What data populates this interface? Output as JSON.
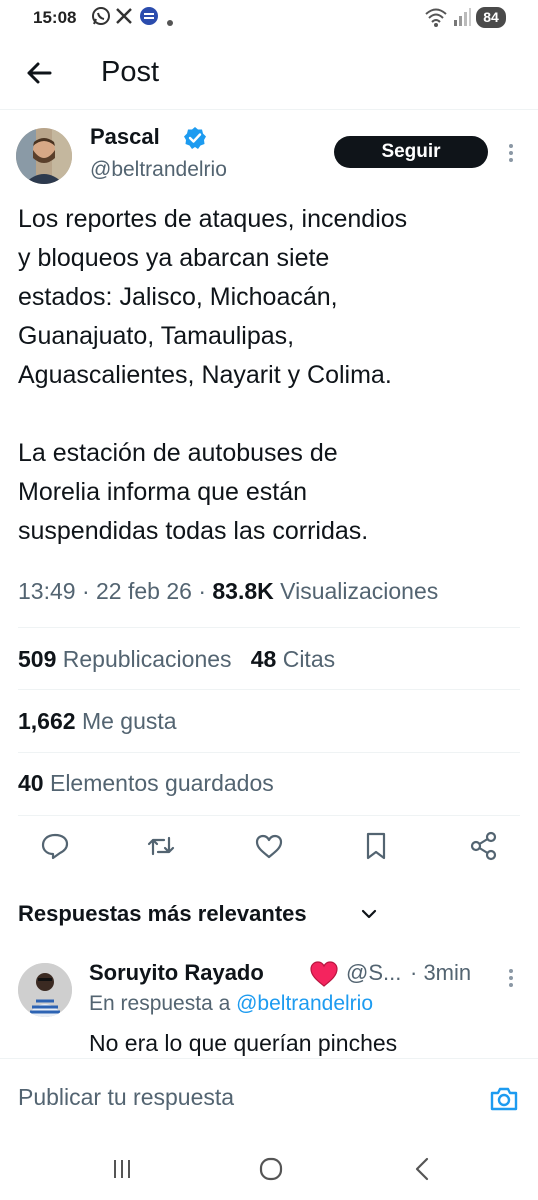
{
  "status_bar": {
    "time": "15:08",
    "battery": "84",
    "icons": [
      "whatsapp-icon",
      "x-icon",
      "app-icon",
      "dot-icon",
      "wifi-icon",
      "signal-icon"
    ]
  },
  "header": {
    "title": "Post",
    "back_icon": "arrow-left-icon"
  },
  "tweet": {
    "author_name": "Pascal",
    "author_handle": "@beltrandelrio",
    "follow_label": "Seguir",
    "text": "Los reportes de ataques, incendios\ny bloqueos ya abarcan siete\nestados: Jalisco, Michoacán,\nGuanajuato, Tamaulipas,\nAguascalientes, Nayarit y Colima.\n\nLa estación de autobuses de\nMorelia informa que están\nsuspendidas todas las corridas.",
    "time": "13:49",
    "date": "22 feb 26",
    "views_count": "83.8K",
    "views_label": "Visualizaciones",
    "reposts_count": "509",
    "reposts_label": "Republicaciones",
    "quotes_count": "48",
    "quotes_label": "Citas",
    "likes_count": "1,662",
    "likes_label": "Me gusta",
    "bookmarks_count": "40",
    "bookmarks_label": "Elementos guardados"
  },
  "actions": [
    "reply-icon",
    "repost-icon",
    "like-icon",
    "bookmark-icon",
    "share-icon"
  ],
  "replies": {
    "heading": "Respuestas más relevantes",
    "items": [
      {
        "name": "Soruyito Rayado",
        "handle": "@S...",
        "time": "· 3min",
        "reply_to_prefix": "En respuesta a",
        "reply_to_handle": "@beltrandelrio",
        "text": "No era lo que querían pinches"
      }
    ]
  },
  "compose": {
    "placeholder": "Publicar tu respuesta"
  },
  "colors": {
    "accent": "#1d9bf0",
    "text": "#0f1419",
    "secondary": "#536471",
    "heart": "#f4245e"
  }
}
